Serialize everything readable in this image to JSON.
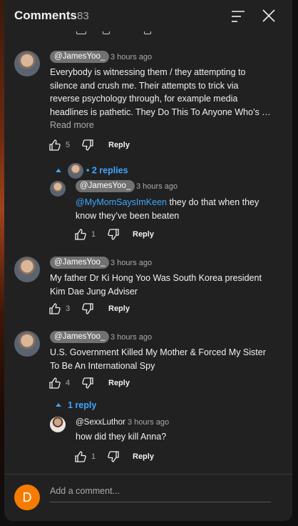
{
  "header": {
    "title": "Comments",
    "count": "83"
  },
  "comments": [
    {
      "author": "@JamesYoo_",
      "time": "3 hours ago",
      "lines": [
        "Everybody is witnessing them / they attempting to",
        "silence and crush me.  Their attempts to trick via",
        "reverse psychology through, for example media",
        "headlines is pathetic. They Do This To Anyone Who’s …"
      ],
      "read_more": "Read more",
      "likes": "5",
      "reply_label": "Reply",
      "replies_toggle": "2 replies"
    },
    {
      "author": "@JamesYoo_",
      "time": "3 hours ago",
      "mention": "@MyMomSaysImKeen",
      "line1_rest": " they do that when they",
      "line2": "know they’ve been beaten",
      "likes": "1",
      "reply_label": "Reply"
    },
    {
      "author": "@JamesYoo_",
      "time": "3 hours ago",
      "lines": [
        "My father Dr Ki Hong Yoo Was South Korea president",
        "Kim Dae Jung  Adviser"
      ],
      "likes": "3",
      "reply_label": "Reply"
    },
    {
      "author": "@JamesYoo_",
      "time": "3 hours ago",
      "lines": [
        "U.S. Government Killed My Mother & Forced My Sister",
        "To Be An International Spy"
      ],
      "likes": "4",
      "reply_label": "Reply",
      "replies_toggle": "1 reply"
    },
    {
      "author": "@SexxLuthor",
      "time": "3 hours ago",
      "lines": [
        "how did they kill Anna?"
      ],
      "likes": "1",
      "reply_label": "Reply"
    }
  ],
  "composer": {
    "avatar_letter": "D",
    "placeholder": "Add a comment..."
  },
  "colors": {
    "panel": "#212121",
    "link": "#3ea6ff",
    "author_chip": "#717171",
    "avatar_composer": "#f57c00"
  }
}
